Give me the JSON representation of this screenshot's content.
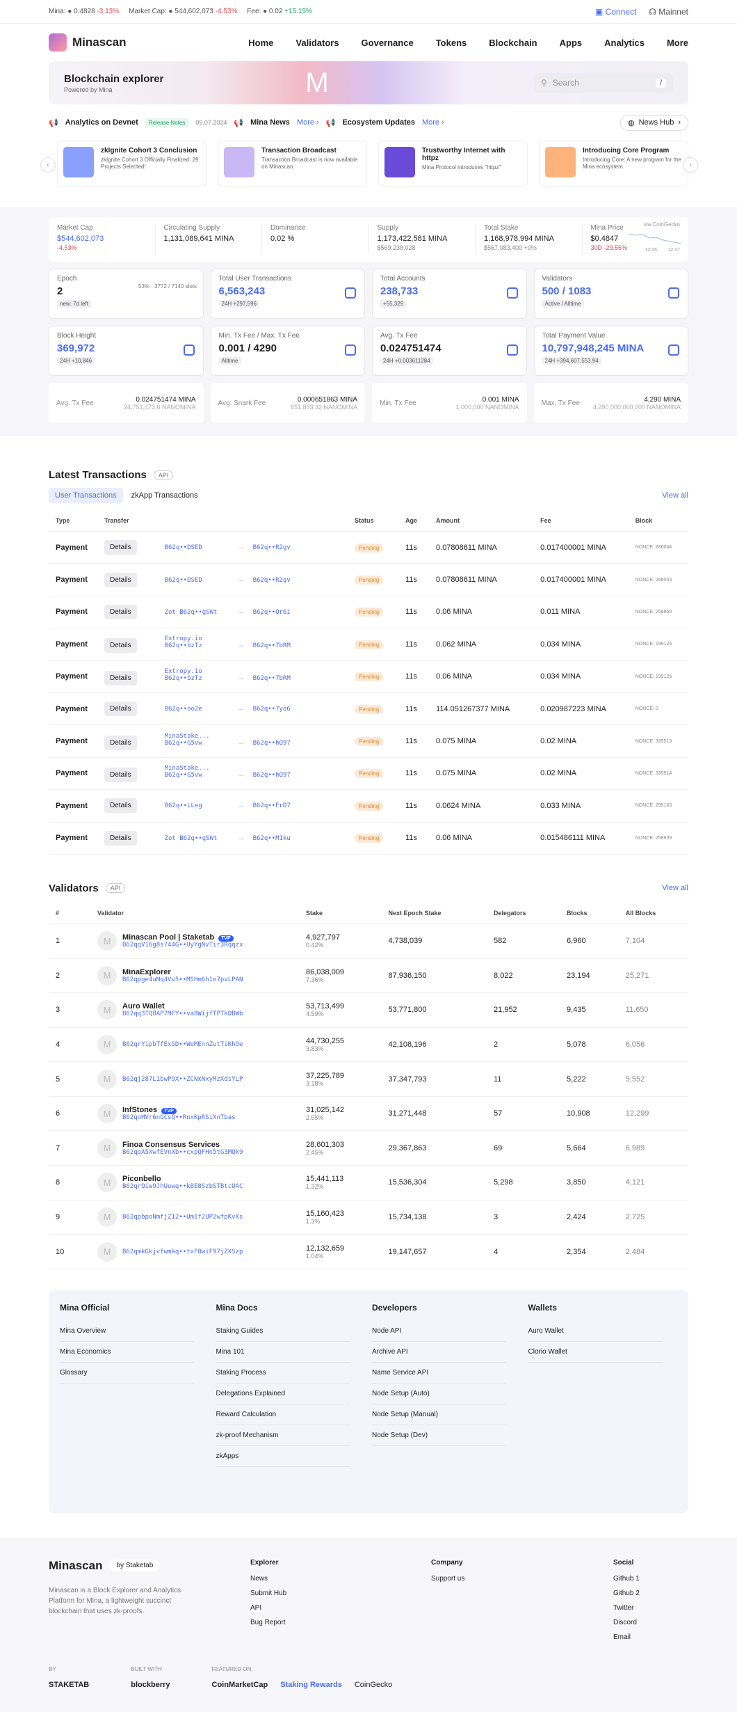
{
  "topbar": {
    "mina_label": "Mina:",
    "mina_price": "0.4828",
    "mina_change": "-3.13%",
    "mcap_label": "Market Cap:",
    "mcap": "544,602,073",
    "mcap_change": "-4.53%",
    "fee_label": "Fee:",
    "fee": "0.02",
    "fee_change": "+15.15%",
    "connect": "Connect",
    "network": "Mainnet"
  },
  "nav": {
    "brand": "Minascan",
    "links": [
      "Home",
      "Validators",
      "Governance",
      "Tokens",
      "Blockchain",
      "Apps",
      "Analytics",
      "More"
    ]
  },
  "hero": {
    "title": "Blockchain explorer",
    "subtitle": "Powered by Mina",
    "search_placeholder": "Search",
    "shortcut": "/"
  },
  "newsbar": {
    "item1": "Analytics on Devnet",
    "release": "Release Notes",
    "date": "09.07.2024",
    "item2": "Mina News",
    "more1": "More",
    "item3": "Ecosystem Updates",
    "more2": "More",
    "hub": "News Hub"
  },
  "news": [
    {
      "title": "zkIgnite Cohort 3 Conclusion",
      "desc": "zkIgnite Cohort 3 Officially Finalized: 29 Projects Selected!",
      "color": "#8aa0ff"
    },
    {
      "title": "Transaction Broadcast",
      "desc": "Transaction Broadcast is now available on Minascan.",
      "color": "#c9b8f5"
    },
    {
      "title": "Trustworthy Internet with httpz",
      "desc": "Mina Protocol introduces \"httpz\"",
      "color": "#6a4ad8"
    },
    {
      "title": "Introducing Core Program",
      "desc": "Introducing Core: A new program for the Mina ecosystem.",
      "color": "#ffb37a"
    }
  ],
  "summary": [
    {
      "label": "Market Cap",
      "value": "$544,602,073",
      "sub": "-4.53%"
    },
    {
      "label": "Circulating Supply",
      "value": "1,131,089,641 MINA",
      "sub": ""
    },
    {
      "label": "Dominance",
      "value": "0.02 %",
      "sub": ""
    },
    {
      "label": "Supply",
      "value": "1,173,422,581 MINA",
      "sub": "$569,238,028"
    },
    {
      "label": "Total Stake",
      "value": "1,168,978,994 MINA",
      "sub": "$567,083,400 +0%"
    },
    {
      "label": "Mina Price",
      "value": "$0.4847",
      "sub": "30D -29.55%"
    }
  ],
  "chart_note": {
    "source": "via CoinGecko",
    "start": "12.06",
    "end": "12.07"
  },
  "boxes": [
    {
      "label": "Epoch",
      "value": "2",
      "pill": "new: 7d left",
      "extra": "53% · 3772 / 7140 slots"
    },
    {
      "label": "Total User Transactions",
      "value": "6,563,243",
      "pill": "24H +297,596"
    },
    {
      "label": "Total Accounts",
      "value": "238,733",
      "pill": "+55,329"
    },
    {
      "label": "Validators",
      "value": "500 / 1083",
      "pill": "Active / Alltime"
    },
    {
      "label": "Block Height",
      "value": "369,972",
      "pill": "24H +10,846"
    },
    {
      "label": "Min. Tx Fee / Max. Tx Fee",
      "value": "0.001 / 4290",
      "pill": "Alltime"
    },
    {
      "label": "Avg. Tx Fee",
      "value": "0.024751474",
      "pill": "24H +0.003611284"
    },
    {
      "label": "Total Payment Value",
      "value": "10,797,948,245 MINA",
      "pill": "24H +394,607,553.94"
    }
  ],
  "avgs": [
    {
      "label": "Avg. Tx Fee",
      "value": "0.024751474 MINA",
      "sub": "24,751,473.6 NANOMINA"
    },
    {
      "label": "Avg. Snark Fee",
      "value": "0.000651863 MINA",
      "sub": "651,863.32 NANOMINA"
    },
    {
      "label": "Min. Tx Fee",
      "value": "0.001 MINA",
      "sub": "1,000,000 NANOMINA"
    },
    {
      "label": "Max. Tx Fee",
      "value": "4,290 MINA",
      "sub": "4,290,000,000,000 NANOMINA"
    }
  ],
  "latest": {
    "title": "Latest Transactions",
    "api": "API",
    "tab1": "User Transactions",
    "tab2": "zkApp Transactions",
    "viewall": "View all",
    "cols": [
      "Type",
      "Transfer",
      "Status",
      "Age",
      "Amount",
      "Fee",
      "Block"
    ],
    "rows": [
      {
        "type": "Payment",
        "btn": "Details",
        "from": "B62q••DSED",
        "to": "B62q••R2gv",
        "status": "Pending",
        "age": "11s",
        "amount": "0.07808611 MINA",
        "fee": "0.017400001 MINA",
        "nonce": "NONCE: 286044"
      },
      {
        "type": "Payment",
        "btn": "Details",
        "from": "B62q••DSED",
        "to": "B62q••R2gv",
        "status": "Pending",
        "age": "11s",
        "amount": "0.07808611 MINA",
        "fee": "0.017400001 MINA",
        "nonce": "NONCE: 286043"
      },
      {
        "type": "Payment",
        "btn": "Details",
        "from": "Zot B62q••gSWt",
        "to": "B62q••Qr6i",
        "status": "Pending",
        "age": "11s",
        "amount": "0.06 MINA",
        "fee": "0.011 MINA",
        "nonce": "NONCE: 258860"
      },
      {
        "type": "Payment",
        "btn": "Details",
        "from": "Extropy.io B62q••bzTz",
        "to": "B62q••7bRM",
        "status": "Pending",
        "age": "11s",
        "amount": "0.062 MINA",
        "fee": "0.034 MINA",
        "nonce": "NONCE: 199126"
      },
      {
        "type": "Payment",
        "btn": "Details",
        "from": "Extropy.io B62q••bzTz",
        "to": "B62q••7bRM",
        "status": "Pending",
        "age": "11s",
        "amount": "0.06 MINA",
        "fee": "0.034 MINA",
        "nonce": "NONCE: 199125"
      },
      {
        "type": "Payment",
        "btn": "Details",
        "from": "B62q••oo2e",
        "to": "B62q••7yo6",
        "status": "Pending",
        "age": "11s",
        "amount": "114.051267377 MINA",
        "fee": "0.020987223 MINA",
        "nonce": "NONCE: 0"
      },
      {
        "type": "Payment",
        "btn": "Details",
        "from": "MinaStake... B62q••G5vw",
        "to": "B62q••hQ97",
        "status": "Pending",
        "age": "11s",
        "amount": "0.075 MINA",
        "fee": "0.02 MINA",
        "nonce": "NONCE: 339513"
      },
      {
        "type": "Payment",
        "btn": "Details",
        "from": "MinaStake... B62q••G5vw",
        "to": "B62q••hQ97",
        "status": "Pending",
        "age": "11s",
        "amount": "0.075 MINA",
        "fee": "0.02 MINA",
        "nonce": "NONCE: 339514"
      },
      {
        "type": "Payment",
        "btn": "Details",
        "from": "B62q••LLeg",
        "to": "B62q••FrD7",
        "status": "Pending",
        "age": "11s",
        "amount": "0.0624 MINA",
        "fee": "0.033 MINA",
        "nonce": "NONCE: 295163"
      },
      {
        "type": "Payment",
        "btn": "Details",
        "from": "Zot B62q••gSWt",
        "to": "B62q••M1ku",
        "status": "Pending",
        "age": "11s",
        "amount": "0.06 MINA",
        "fee": "0.015486111 MINA",
        "nonce": "NONCE: 258939"
      }
    ]
  },
  "validators": {
    "title": "Validators",
    "api": "API",
    "viewall": "View all",
    "cols": [
      "#",
      "Validator",
      "Stake",
      "Next Epoch Stake",
      "Delegators",
      "Blocks",
      "All Blocks"
    ],
    "rows": [
      {
        "n": "1",
        "name": "Minascan Pool | Staketab",
        "addr": "B62qqV16g8s744G••UyYgNvTir3Rqqzx",
        "stake": "4,927,797",
        "pct": "0.42%",
        "next": "4,738,039",
        "del": "582",
        "blocks": "6,960",
        "all": "7,104",
        "tvp": true
      },
      {
        "n": "2",
        "name": "MinaExplorer",
        "addr": "B62qpge4uMq4Vv5••MSHm6h1o7pvLPAN",
        "stake": "86,038,009",
        "pct": "7.36%",
        "next": "87,936,150",
        "del": "8,022",
        "blocks": "23,194",
        "all": "25,271",
        "tvp": false
      },
      {
        "n": "3",
        "name": "Auro Wallet",
        "addr": "B62qq3TQ8AP7MFY••va8WijfTPTkDBWb",
        "stake": "53,713,499",
        "pct": "4.59%",
        "next": "53,771,800",
        "del": "21,952",
        "blocks": "9,435",
        "all": "11,650",
        "tvp": false
      },
      {
        "n": "4",
        "name": "",
        "addr": "B62qrYipbTfExSD••WeMEnnZutTiKhOe",
        "stake": "44,730,255",
        "pct": "3.83%",
        "next": "42,108,196",
        "del": "2",
        "blocks": "5,078",
        "all": "6,056",
        "tvp": false
      },
      {
        "n": "5",
        "name": "",
        "addr": "B62qj287L1bwP9X••ZCNxNxyMzXdsYLP",
        "stake": "37,225,789",
        "pct": "3.18%",
        "next": "37,347,793",
        "del": "11",
        "blocks": "5,222",
        "all": "5,552",
        "tvp": false
      },
      {
        "n": "6",
        "name": "InfStones",
        "addr": "B62qoHVr6nGCsQ••RnxKpRSiXnTbas",
        "stake": "31,025,142",
        "pct": "2.65%",
        "next": "31,271,448",
        "del": "57",
        "blocks": "10,908",
        "all": "12,299",
        "tvp": true
      },
      {
        "n": "7",
        "name": "Finoa Consensus Services",
        "addr": "B62qoA5XwfEVnXb••cxpQFHn5tG3MQk9",
        "stake": "28,601,303",
        "pct": "2.45%",
        "next": "29,367,863",
        "del": "69",
        "blocks": "5,664",
        "all": "6,989",
        "tvp": false
      },
      {
        "n": "8",
        "name": "Piconbello",
        "addr": "B62qrQiw9JhUuwq••kBE8SzbSTBtcUAC",
        "stake": "15,441,113",
        "pct": "1.32%",
        "next": "15,536,304",
        "del": "5,298",
        "blocks": "3,850",
        "all": "4,121",
        "tvp": false
      },
      {
        "n": "9",
        "name": "",
        "addr": "B62qpbpoNmfjZ12••Um1f2UP2wfpKvXs",
        "stake": "15,160,423",
        "pct": "1.3%",
        "next": "15,734,138",
        "del": "3",
        "blocks": "2,424",
        "all": "2,725",
        "tvp": false
      },
      {
        "n": "10",
        "name": "",
        "addr": "B62qmkGkjvfwmkq••txFOwiF97jZXSzp",
        "stake": "12,132,659",
        "pct": "1.04%",
        "next": "19,147,657",
        "del": "4",
        "blocks": "2,354",
        "all": "2,484",
        "tvp": false
      }
    ]
  },
  "footbox": {
    "cols": [
      {
        "title": "Mina Official",
        "items": [
          "Mina Overview",
          "Mina Economics",
          "Glossary"
        ]
      },
      {
        "title": "Mina Docs",
        "items": [
          "Staking Guides",
          "Mina 101",
          "Staking Process",
          "Delegations Explained",
          "Reward Calculation",
          "zk-proof Mechanism",
          "zkApps"
        ]
      },
      {
        "title": "Developers",
        "items": [
          "Node API",
          "Archive API",
          "Name Service API",
          "Node Setup (Auto)",
          "Node Setup (Manual)",
          "Node Setup (Dev)"
        ]
      },
      {
        "title": "Wallets",
        "items": [
          "Auro Wallet",
          "Clorio Wallet"
        ]
      }
    ]
  },
  "footer": {
    "brand": "Minascan",
    "by": "by Staketab",
    "desc": "Minascan is a Block Explorer and Analytics Platform for Mina, a lightweight succinct blockchain that uses zk-proofs.",
    "explorer": {
      "title": "Explorer",
      "items": [
        "News",
        "Submit Hub",
        "API",
        "Bug Report"
      ]
    },
    "company": {
      "title": "Company",
      "items": [
        "Support us"
      ]
    },
    "social": {
      "title": "Social",
      "items": [
        "Github 1",
        "Github 2",
        "Twitter",
        "Discord",
        "Email"
      ]
    },
    "by_label": "BY",
    "by_val": "STAKETAB",
    "built_label": "BUILT WITH",
    "built_val": "blockberry",
    "feat_label": "FEATURED ON",
    "feat1": "CoinMarketCap",
    "feat2": "Staking Rewards",
    "feat3": "CoinGecko"
  }
}
